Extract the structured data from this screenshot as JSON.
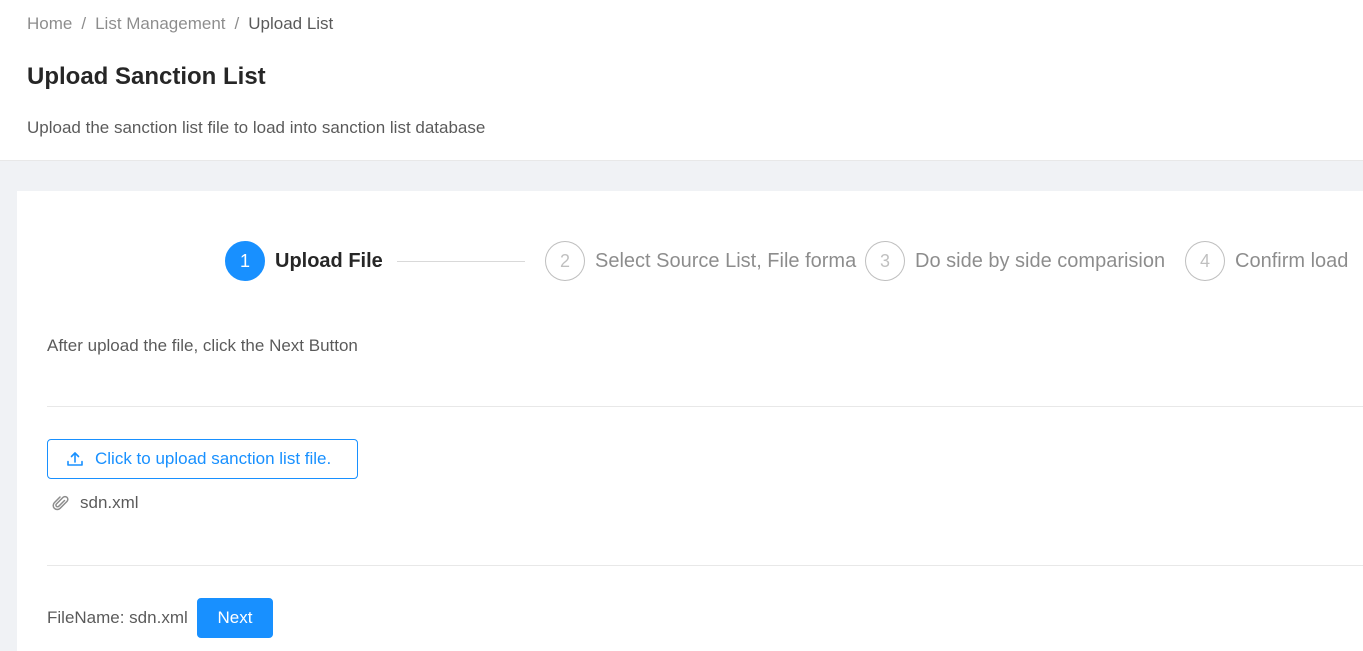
{
  "breadcrumb": {
    "items": [
      "Home",
      "List Management",
      "Upload List"
    ],
    "separator": "/"
  },
  "header": {
    "title": "Upload Sanction List",
    "description": "Upload the sanction list file to load into sanction list database"
  },
  "steps": [
    {
      "number": "1",
      "title": "Upload File",
      "status": "active"
    },
    {
      "number": "2",
      "title": "Select Source List, File forma",
      "status": "waiting"
    },
    {
      "number": "3",
      "title": "Do side by side comparision",
      "status": "waiting"
    },
    {
      "number": "4",
      "title": "Confirm load",
      "status": "waiting"
    }
  ],
  "content": {
    "instruction": "After upload the file, click the Next Button",
    "upload_button_label": "Click to upload sanction list file.",
    "uploaded_file": "sdn.xml",
    "footer_label": "FileName: sdn.xml",
    "next_button_label": "Next"
  },
  "icons": {
    "upload": "upload-icon",
    "attachment": "paperclip-icon"
  },
  "colors": {
    "primary": "#1890ff",
    "page_background": "#f0f2f5"
  }
}
